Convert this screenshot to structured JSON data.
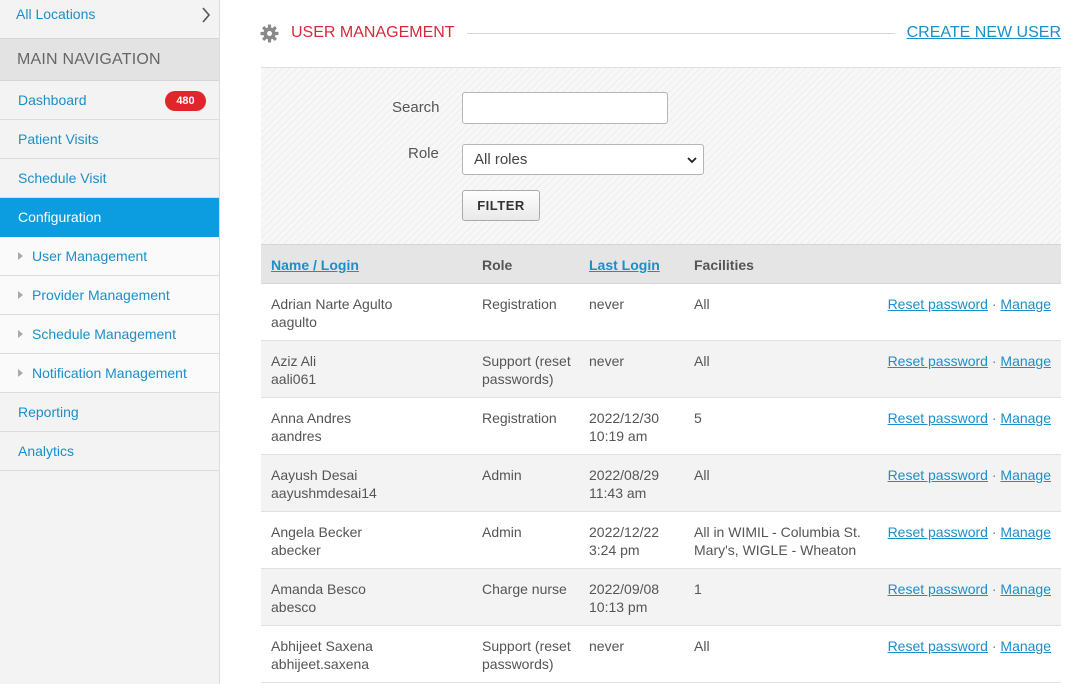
{
  "sidebar": {
    "location": "All Locations",
    "section_header": "MAIN NAVIGATION",
    "items": [
      {
        "label": "Dashboard",
        "badge": "480"
      },
      {
        "label": "Patient Visits"
      },
      {
        "label": "Schedule Visit"
      },
      {
        "label": "Configuration",
        "active": true
      },
      {
        "label": "User Management",
        "sub": true
      },
      {
        "label": "Provider Management",
        "sub": true
      },
      {
        "label": "Schedule Management",
        "sub": true
      },
      {
        "label": "Notification Management",
        "sub": true
      },
      {
        "label": "Reporting"
      },
      {
        "label": "Analytics"
      }
    ]
  },
  "header": {
    "title": "USER MANAGEMENT",
    "create_link": "CREATE NEW USER"
  },
  "filter": {
    "search_label": "Search",
    "search_value": "",
    "role_label": "Role",
    "role_selected": "All roles",
    "button": "FILTER"
  },
  "table": {
    "columns": [
      "Name / Login",
      "Role",
      "Last Login",
      "Facilities"
    ],
    "action_reset": "Reset password",
    "action_separator": "·",
    "action_manage": "Manage",
    "rows": [
      {
        "name": "Adrian Narte Agulto",
        "login": "aagulto",
        "role": "Registration",
        "last_login": "never",
        "facilities": "All"
      },
      {
        "name": "Aziz Ali",
        "login": "aali061",
        "role": "Support (reset passwords)",
        "last_login": "never",
        "facilities": "All"
      },
      {
        "name": "Anna Andres",
        "login": "aandres",
        "role": "Registration",
        "last_login": "2022/12/30 10:19 am",
        "facilities": "5"
      },
      {
        "name": "Aayush Desai",
        "login": "aayushmdesai14",
        "role": "Admin",
        "last_login": "2022/08/29 11:43 am",
        "facilities": "All"
      },
      {
        "name": "Angela Becker",
        "login": "abecker",
        "role": "Admin",
        "last_login": "2022/12/22 3:24 pm",
        "facilities": "All in WIMIL - Columbia St. Mary's, WIGLE - Wheaton"
      },
      {
        "name": "Amanda Besco",
        "login": "abesco",
        "role": "Charge nurse",
        "last_login": "2022/09/08 10:13 pm",
        "facilities": "1"
      },
      {
        "name": "Abhijeet Saxena",
        "login": "abhijeet.saxena",
        "role": "Support (reset passwords)",
        "last_login": "never",
        "facilities": "All"
      }
    ]
  },
  "colors": {
    "accent_blue": "#1a8fc9",
    "active_nav": "#0c9de0",
    "title_red": "#d6283a",
    "badge_red": "#e0262b"
  }
}
